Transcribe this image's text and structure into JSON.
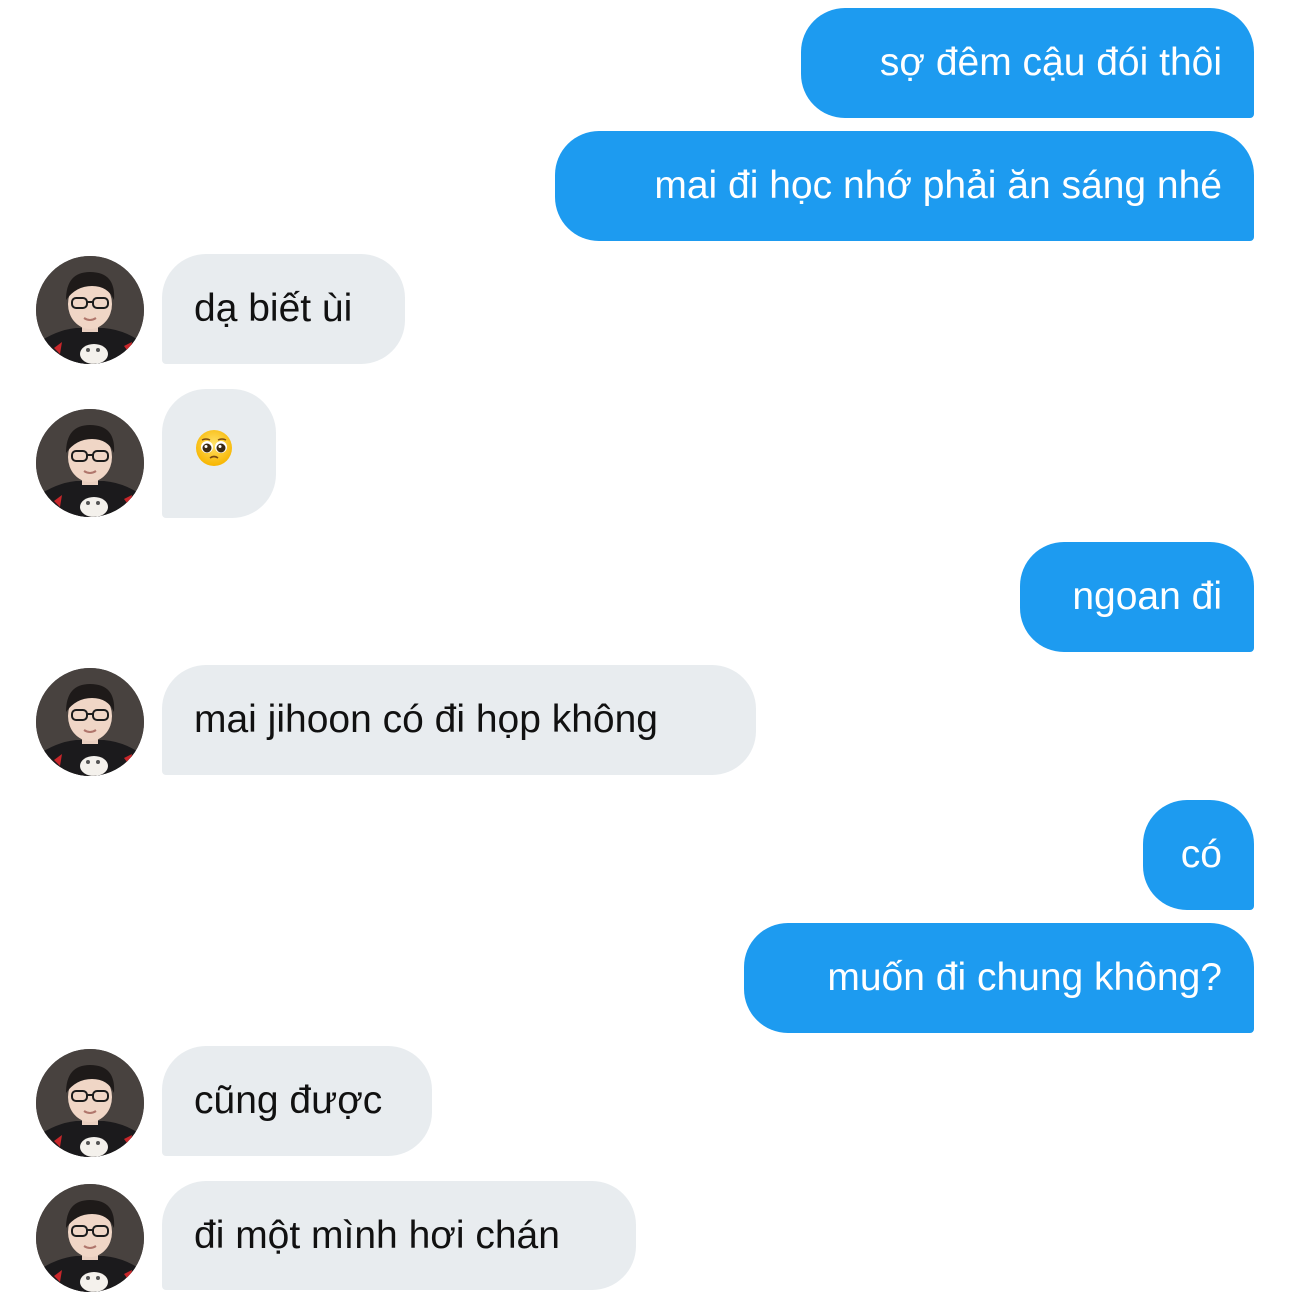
{
  "colors": {
    "sent_bubble": "#1d9bf0",
    "received_bubble": "#e8ecef",
    "sent_text": "#ffffff",
    "received_text": "#111111"
  },
  "messages": [
    {
      "direction": "sent",
      "text": "sợ đêm cậu đói thôi"
    },
    {
      "direction": "sent",
      "text": "mai đi học nhớ phải ăn sáng nhé"
    },
    {
      "direction": "received",
      "text": "dạ biết ùi",
      "avatar_icon": "avatar-photo"
    },
    {
      "direction": "received",
      "text": "",
      "emoji_icon": "pleading-face-emoji",
      "avatar_icon": "avatar-photo"
    },
    {
      "direction": "sent",
      "text": "ngoan đi"
    },
    {
      "direction": "received",
      "text": "mai jihoon có đi họp không",
      "avatar_icon": "avatar-photo"
    },
    {
      "direction": "sent",
      "text": "có"
    },
    {
      "direction": "sent",
      "text": "muốn đi chung không?"
    },
    {
      "direction": "received",
      "text": "cũng được",
      "avatar_icon": "avatar-photo"
    },
    {
      "direction": "received",
      "text": "đi một mình hơi chán",
      "avatar_icon": "avatar-photo"
    }
  ]
}
